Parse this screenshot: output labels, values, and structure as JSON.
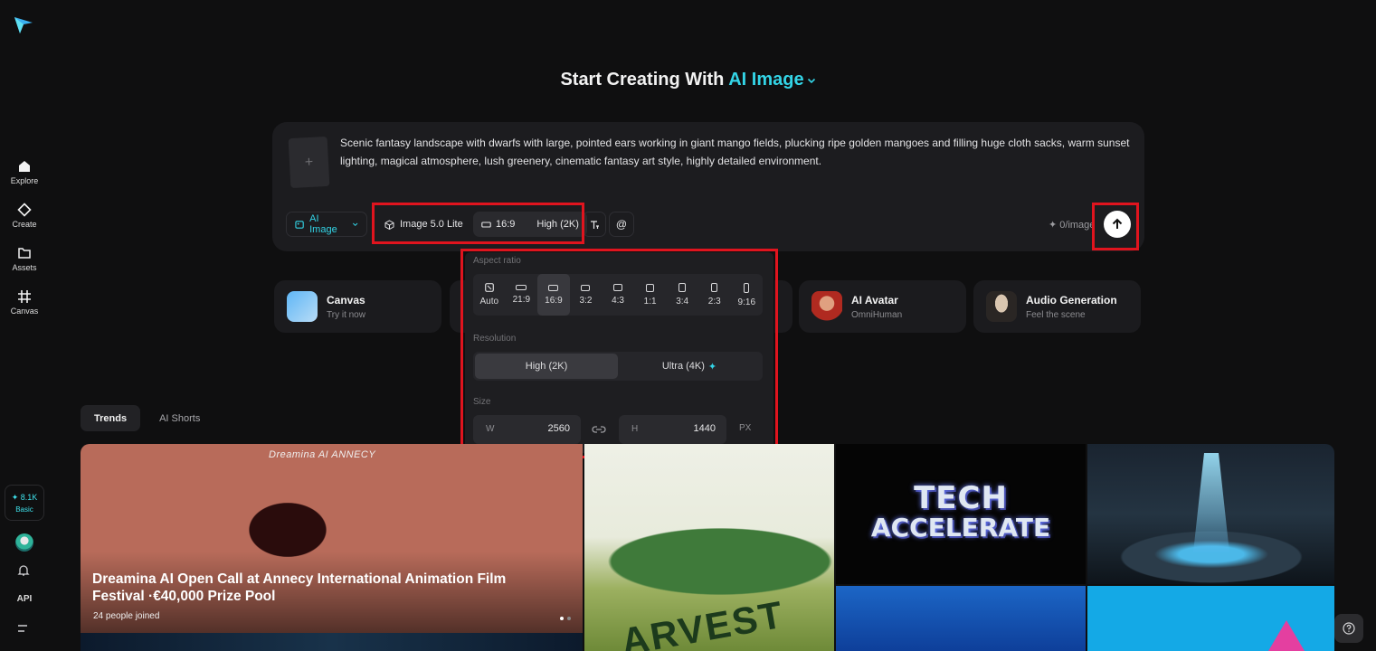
{
  "sidebar": {
    "items": [
      {
        "label": "Explore",
        "icon": "home-icon"
      },
      {
        "label": "Create",
        "icon": "diamond-icon"
      },
      {
        "label": "Assets",
        "icon": "folder-icon"
      },
      {
        "label": "Canvas",
        "icon": "canvas-icon"
      }
    ],
    "credits": {
      "value": "✦ 8.1K",
      "tier": "Basic"
    },
    "api_label": "API"
  },
  "heading": {
    "prefix": "Start Creating With",
    "mode": "AI Image"
  },
  "prompt": {
    "text": "Scenic fantasy landscape with dwarfs with large, pointed ears working in giant mango fields, plucking ripe golden mangoes and filling huge cloth sacks, warm sunset lighting, magical atmosphere, lush greenery, cinematic fantasy art style, highly detailed environment.",
    "mode_chip": "AI Image",
    "model_chip": "Image 5.0 Lite",
    "ratio_chip": "16:9",
    "resolution_chip": "High (2K)",
    "counter": "✦ 0/image"
  },
  "features": [
    {
      "title": "Canvas",
      "subtitle": "Try it now"
    },
    {
      "title": "AI Avatar",
      "subtitle": "OmniHuman"
    },
    {
      "title": "Audio Generation",
      "subtitle": "Feel the scene"
    }
  ],
  "popover": {
    "aspect_label": "Aspect ratio",
    "ratios": [
      "Auto",
      "21:9",
      "16:9",
      "3:2",
      "4:3",
      "1:1",
      "3:4",
      "2:3",
      "9:16"
    ],
    "selected_ratio": "16:9",
    "resolution_label": "Resolution",
    "resolutions": [
      "High (2K)",
      "Ultra (4K)"
    ],
    "selected_resolution": "High (2K)",
    "size_label": "Size",
    "width_key": "W",
    "width": "2560",
    "height_key": "H",
    "height": "1440",
    "unit": "PX"
  },
  "tabs": [
    {
      "label": "Trends",
      "active": true
    },
    {
      "label": "AI Shorts",
      "active": false
    }
  ],
  "gallery": {
    "featured": {
      "brand": "Dreamina AI   ANNECY",
      "title": "Dreamina AI Open Call at Annecy International Animation Film Festival ·€40,000 Prize Pool",
      "joined": "24  people joined"
    },
    "harvest_word": "ARVEST",
    "tech_line1": "TECH",
    "tech_line2": "ACCELERATE"
  },
  "colors": {
    "accent": "#33d4e6",
    "highlight": "#e0141e",
    "background": "#0f0f10"
  }
}
